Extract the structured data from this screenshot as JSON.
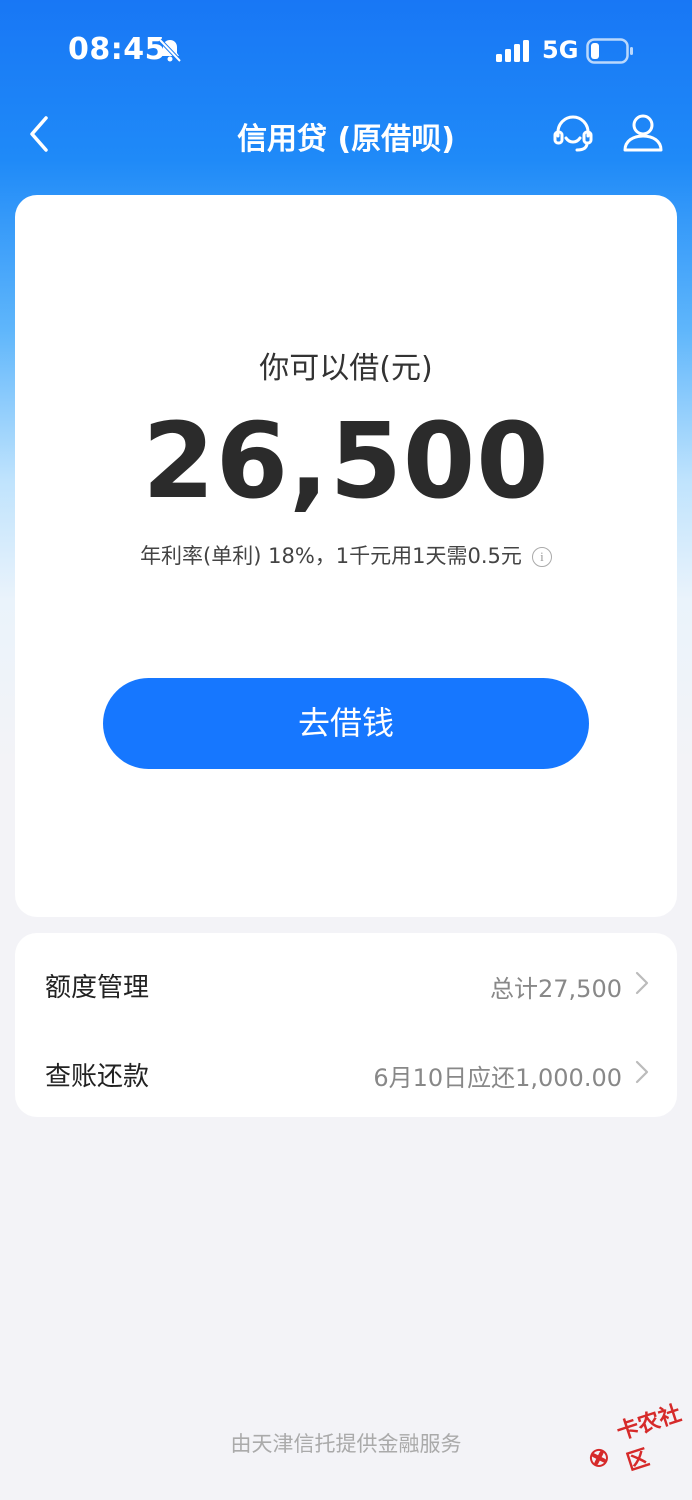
{
  "status_bar": {
    "time": "08:45",
    "network": "5G"
  },
  "nav": {
    "title": "信用贷 (原借呗)"
  },
  "loan": {
    "label": "你可以借(元)",
    "amount": "26,500",
    "rate_text": "年利率(单利) 18%，1千元用1天需0.5元",
    "cta_label": "去借钱"
  },
  "menu": {
    "items": [
      {
        "label": "额度管理",
        "value": "总计27,500"
      },
      {
        "label": "查账还款",
        "value": "6月10日应还1,000.00"
      }
    ]
  },
  "footer": {
    "text": "由天津信托提供金融服务"
  },
  "watermark": {
    "text": "卡农社区"
  },
  "colors": {
    "primary": "#1677ff",
    "card": "#ffffff",
    "page_bg": "#f3f3f7"
  },
  "icons": [
    "bell-off-icon",
    "signal-icon",
    "battery-icon",
    "back-icon",
    "customer-service-icon",
    "user-icon",
    "info-icon",
    "chevron-right-icon"
  ]
}
